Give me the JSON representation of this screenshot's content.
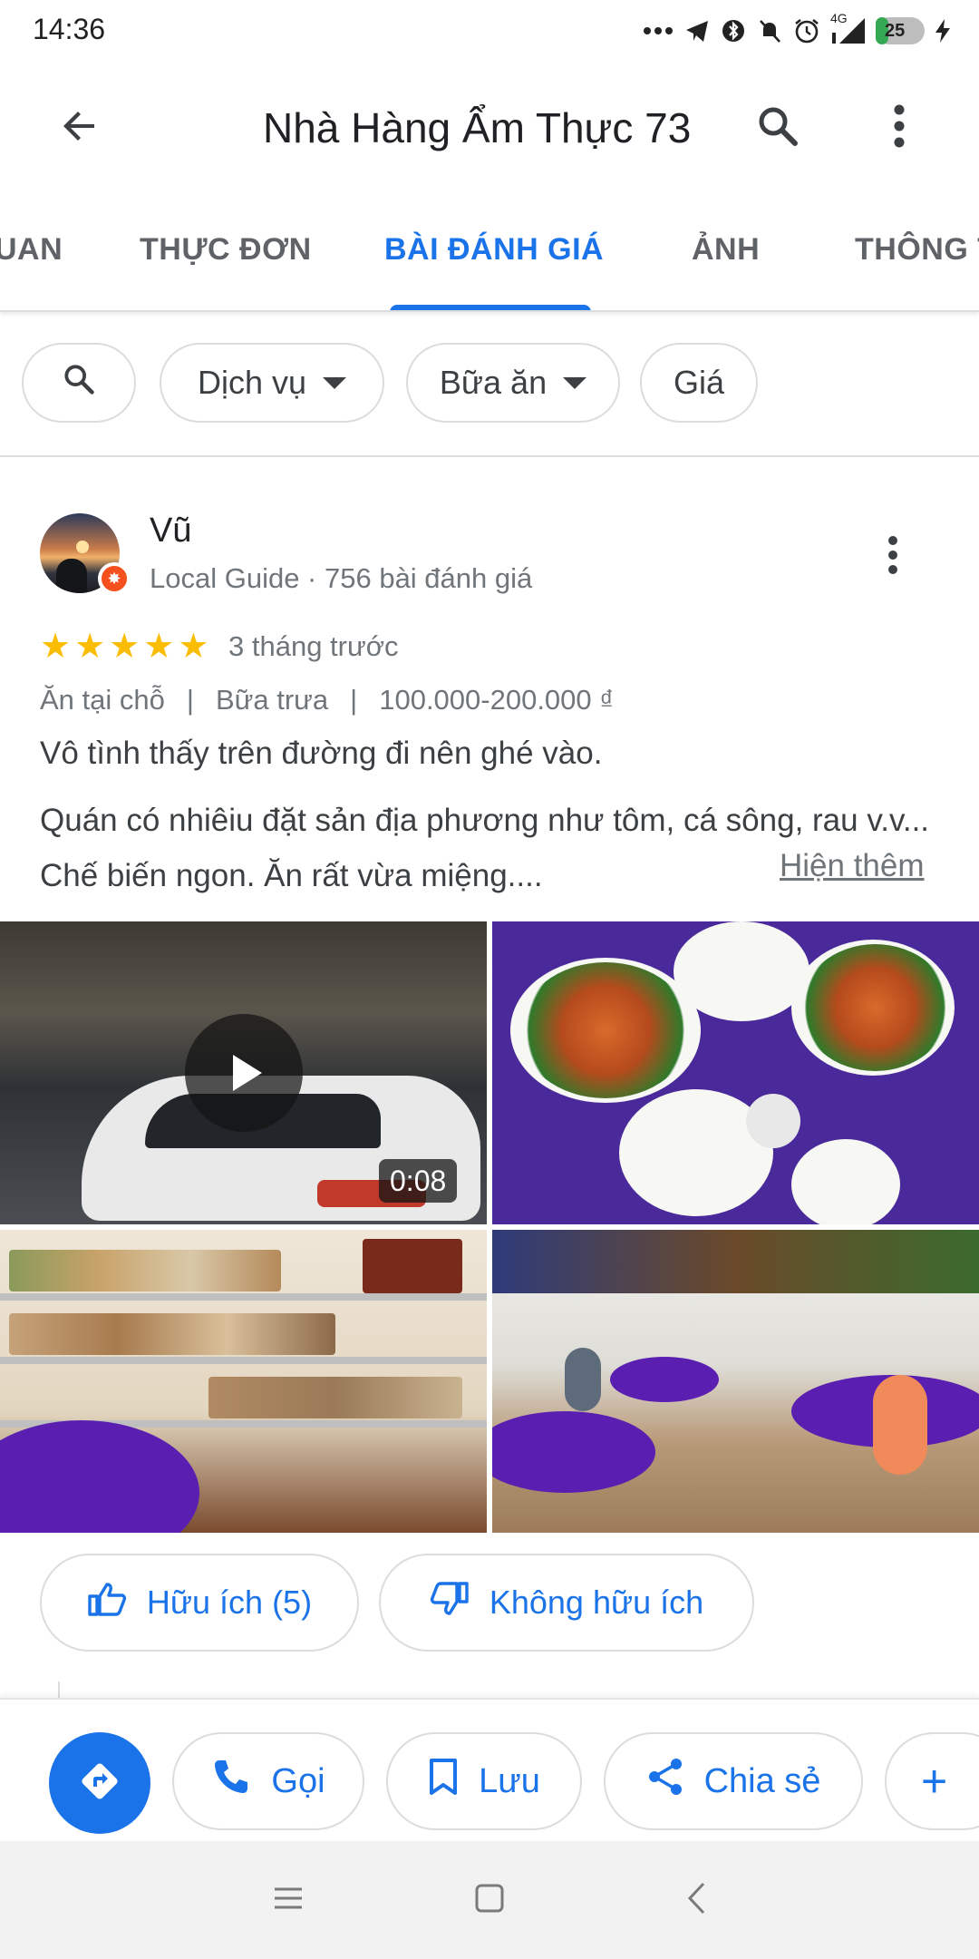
{
  "status_bar": {
    "time": "14:36",
    "network": "4G",
    "battery": "25",
    "battery_fraction": 0.25
  },
  "app_bar": {
    "title": "Nhà Hàng Ẩm Thực 73",
    "icons": [
      "arrow-back-icon",
      "search-icon",
      "more-vert-icon"
    ]
  },
  "tabs": [
    {
      "label": "UAN",
      "active": false
    },
    {
      "label": "THỰC ĐƠN",
      "active": false
    },
    {
      "label": "BÀI ĐÁNH GIÁ",
      "active": true
    },
    {
      "label": "ẢNH",
      "active": false
    },
    {
      "label": "THÔNG T",
      "active": false
    }
  ],
  "filters": {
    "search_icon": "search-icon",
    "chips": [
      "Dịch vụ",
      "Bữa ăn",
      "Giá"
    ]
  },
  "review": {
    "author": "Vũ",
    "meta": "Local Guide · 756 bài đánh giá",
    "rating": 5,
    "rating_max": 5,
    "date": "3 tháng trước",
    "tags": [
      "Ăn tại chỗ",
      "Bữa trưa",
      "100.000-200.000 ₫"
    ],
    "tag_separator": "|",
    "line1": "Vô tình thấy trên đường đi nên ghé vào.",
    "body": "Quán có nhiêiu đặt sản địa phương như tôm, cá sông, rau v.v... Chế biến ngon. Ăn rất vừa miệng....",
    "read_more": "Hiện thêm",
    "video_duration": "0:08",
    "helpful": "Hữu ích (5)",
    "not_helpful": "Không hữu ích"
  },
  "actions": {
    "call": "Gọi",
    "save": "Lưu",
    "share": "Chia sẻ",
    "more": "+"
  },
  "colors": {
    "accent": "#1a73e8",
    "star": "#fbbc04",
    "secondary_text": "#70757a",
    "guide_badge": "#f4511e"
  }
}
